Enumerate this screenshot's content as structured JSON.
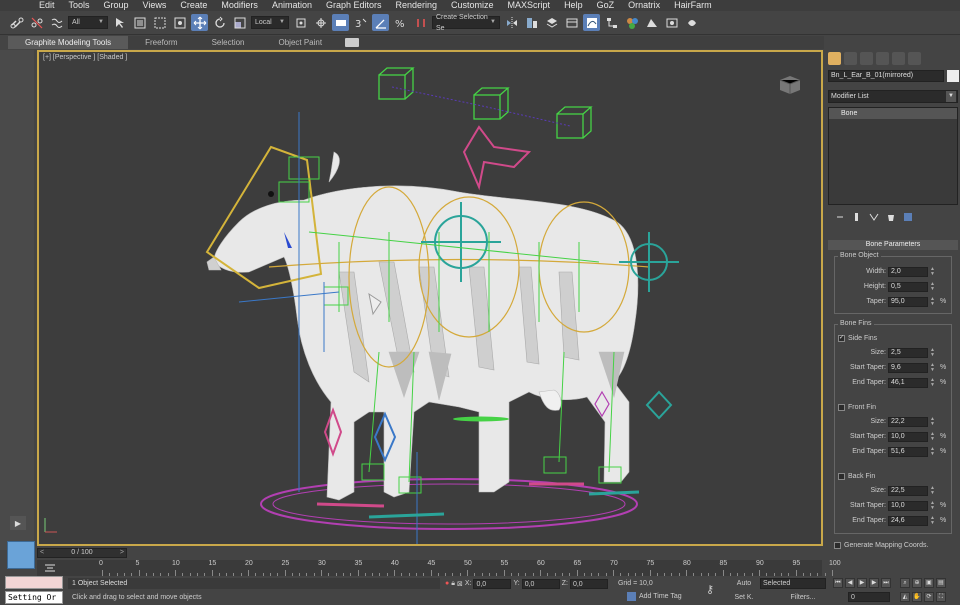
{
  "menu": [
    "Edit",
    "Tools",
    "Group",
    "Views",
    "Create",
    "Modifiers",
    "Animation",
    "Graph Editors",
    "Rendering",
    "Customize",
    "MAXScript",
    "Help",
    "GoZ",
    "Ornatrix",
    "HairFarm"
  ],
  "toolbar": {
    "selection_filter": "All",
    "coord_system": "Local",
    "named_selection": "Create Selection Se"
  },
  "ribbon": {
    "tabs": [
      "Graphite Modeling Tools",
      "Freeform",
      "Selection",
      "Object Paint"
    ]
  },
  "viewport": {
    "label": "[+] [Perspective ] [Shaded ]"
  },
  "timeline": {
    "frame": "0 / 100",
    "left": "<",
    "right": ">"
  },
  "ruler": {
    "labels": [
      "0",
      "5",
      "10",
      "15",
      "20",
      "25",
      "30",
      "35",
      "40",
      "45",
      "50",
      "55",
      "60",
      "65",
      "70",
      "75",
      "80",
      "85",
      "90",
      "95",
      "100"
    ]
  },
  "status": {
    "selected": "1 Object Selected",
    "prompt": "Click and drag to select and move objects",
    "maxscript_text": "Setting Or",
    "x_label": "X:",
    "x": "0,0",
    "y_label": "Y:",
    "y": "0,0",
    "z_label": "Z:",
    "z": "0,0",
    "grid": "Grid = 10,0",
    "add_time_tag": "Add Time Tag",
    "auto_key": "Auto",
    "set_key": "Set K.",
    "key_filter": "Selected",
    "filters": "Filters...",
    "frame_field": "0"
  },
  "command_panel": {
    "object_name": "Bn_L_Ear_B_01(mirrored)",
    "modifier_list": "Modifier List",
    "stack_item": "Bone",
    "rollout_title": "Bone Parameters",
    "bone_object": {
      "title": "Bone Object",
      "width_label": "Width:",
      "width": "2,0",
      "height_label": "Height:",
      "height": "0,5",
      "taper_label": "Taper:",
      "taper": "95,0"
    },
    "bone_fins": {
      "title": "Bone Fins",
      "side_fins": "Side Fins",
      "side_size": "2,5",
      "side_start": "9,6",
      "side_end": "46,1",
      "front_fin": "Front Fin",
      "front_size": "22,2",
      "front_start": "10,0",
      "front_end": "51,6",
      "back_fin": "Back Fin",
      "back_size": "22,5",
      "back_start": "10,0",
      "back_end": "24,6",
      "size_label": "Size:",
      "start_label": "Start Taper:",
      "end_label": "End Taper:",
      "pct": "%"
    },
    "gen_mapping": "Generate Mapping Coords."
  },
  "colors": {
    "viewport_border": "#c9a84a",
    "active_tool": "#5b7fb7",
    "bone_green": "#46d246",
    "gizmo_teal": "#2aa49a",
    "gizmo_pink": "#d04a8a",
    "ring_purple": "#b23fb2",
    "head_yellow": "#d4b43a"
  }
}
